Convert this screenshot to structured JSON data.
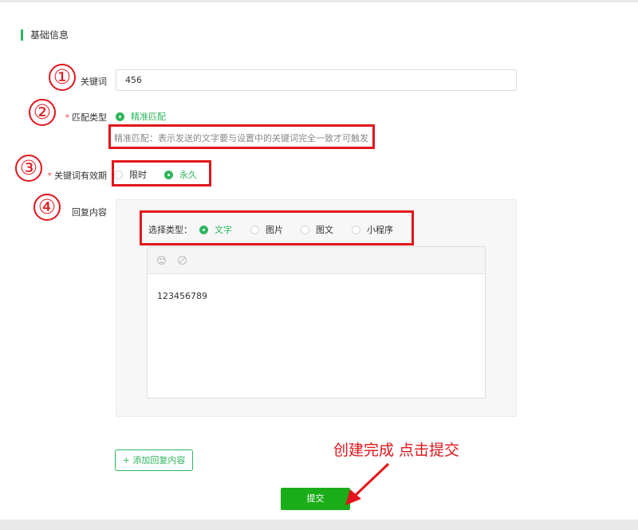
{
  "section": {
    "title": "基础信息"
  },
  "form": {
    "keyword": {
      "label": "关键词",
      "value": "456"
    },
    "match_type": {
      "label": "匹配类型",
      "option": "精准匹配",
      "hint": "精准匹配：表示发送的文字要与设置中的关键词完全一致才可触发"
    },
    "validity": {
      "label": "关键词有效期",
      "options": [
        "限时",
        "永久"
      ],
      "selected": "永久"
    },
    "reply": {
      "label": "回复内容",
      "type_label": "选择类型：",
      "types": [
        "文字",
        "图片",
        "图文",
        "小程序"
      ],
      "selected_type": "文字",
      "content": "123456789"
    },
    "add_reply_label": "+ 添加回复内容",
    "submit_label": "提交"
  },
  "annotations": {
    "markers": [
      "①",
      "②",
      "③",
      "④"
    ],
    "instruction": "创建完成 点击提交",
    "color": "#e2151b"
  },
  "colors": {
    "accent": "#2db55d",
    "submit": "#1aad19"
  },
  "icons": [
    "emoji-icon",
    "no-entry-icon"
  ]
}
